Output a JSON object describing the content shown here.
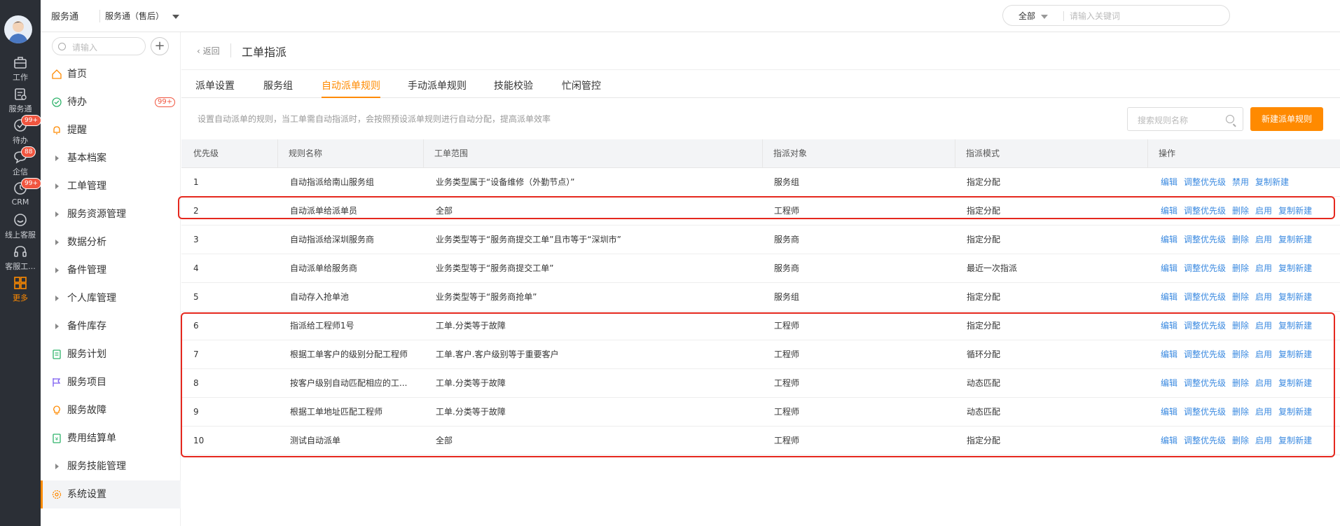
{
  "rail": {
    "items": [
      {
        "label": "工作",
        "icon": "briefcase-icon"
      },
      {
        "label": "服务通",
        "icon": "service-clipboard-icon"
      },
      {
        "label": "待办",
        "icon": "check-circle-icon",
        "badge": "99+"
      },
      {
        "label": "企信",
        "icon": "chat-bubble-icon",
        "badge": "88"
      },
      {
        "label": "CRM",
        "icon": "clock-icon",
        "badge": "99+"
      },
      {
        "label": "线上客服",
        "icon": "smile-icon"
      },
      {
        "label": "客服工...",
        "icon": "headset-icon"
      },
      {
        "label": "更多",
        "icon": "grid-icon"
      }
    ]
  },
  "topbar": {
    "brand": "服务通",
    "app": "服务通（售后）",
    "search_scope": "全部",
    "search_placeholder": "请输入关键词"
  },
  "sidebar": {
    "search_placeholder": "请输入",
    "items": [
      {
        "label": "首页"
      },
      {
        "label": "待办",
        "badge": "99+"
      },
      {
        "label": "提醒"
      },
      {
        "label": "基本档案"
      },
      {
        "label": "工单管理"
      },
      {
        "label": "服务资源管理"
      },
      {
        "label": "数据分析"
      },
      {
        "label": "备件管理"
      },
      {
        "label": "个人库管理"
      },
      {
        "label": "备件库存"
      },
      {
        "label": "服务计划"
      },
      {
        "label": "服务项目"
      },
      {
        "label": "服务故障"
      },
      {
        "label": "费用结算单"
      },
      {
        "label": "服务技能管理"
      },
      {
        "label": "系统设置"
      }
    ]
  },
  "main": {
    "back": "返回",
    "title": "工单指派",
    "tabs": [
      "派单设置",
      "服务组",
      "自动派单规则",
      "手动派单规则",
      "技能校验",
      "忙闲管控"
    ],
    "active_tab": "自动派单规则",
    "hint": "设置自动派单的规则，当工单需自动指派时，会按照预设派单规则进行自动分配，提高派单效率",
    "rule_search_placeholder": "搜索规则名称",
    "new_button": "新建派单规则"
  },
  "table": {
    "headers": [
      "优先级",
      "规则名称",
      "工单范围",
      "指派对象",
      "指派模式",
      "操作"
    ],
    "rows": [
      {
        "priority": "1",
        "name": "自动指派给南山服务组",
        "scope": "业务类型属于“设备维修（外勤节点）”",
        "target": "服务组",
        "mode": "指定分配",
        "ops": [
          "编辑",
          "调整优先级",
          "禁用",
          "复制新建"
        ]
      },
      {
        "priority": "2",
        "name": "自动派单给派单员",
        "scope": "全部",
        "target": "工程师",
        "mode": "指定分配",
        "ops": [
          "编辑",
          "调整优先级",
          "删除",
          "启用",
          "复制新建"
        ]
      },
      {
        "priority": "3",
        "name": "自动指派给深圳服务商",
        "scope": "业务类型等于“服务商提交工单”且市等于“深圳市”",
        "target": "服务商",
        "mode": "指定分配",
        "ops": [
          "编辑",
          "调整优先级",
          "删除",
          "启用",
          "复制新建"
        ]
      },
      {
        "priority": "4",
        "name": "自动派单给服务商",
        "scope": "业务类型等于“服务商提交工单”",
        "target": "服务商",
        "mode": "最近一次指派",
        "ops": [
          "编辑",
          "调整优先级",
          "删除",
          "启用",
          "复制新建"
        ]
      },
      {
        "priority": "5",
        "name": "自动存入抢单池",
        "scope": "业务类型等于“服务商抢单”",
        "target": "服务组",
        "mode": "指定分配",
        "ops": [
          "编辑",
          "调整优先级",
          "删除",
          "启用",
          "复制新建"
        ]
      },
      {
        "priority": "6",
        "name": "指派给工程师1号",
        "scope": "工单.分类等于故障",
        "target": "工程师",
        "mode": "指定分配",
        "ops": [
          "编辑",
          "调整优先级",
          "删除",
          "启用",
          "复制新建"
        ]
      },
      {
        "priority": "7",
        "name": "根据工单客户的级别分配工程师",
        "scope": "工单.客户.客户级别等于重要客户",
        "target": "工程师",
        "mode": "循环分配",
        "ops": [
          "编辑",
          "调整优先级",
          "删除",
          "启用",
          "复制新建"
        ]
      },
      {
        "priority": "8",
        "name": "按客户级别自动匹配相应的工...",
        "scope": "工单.分类等于故障",
        "target": "工程师",
        "mode": "动态匹配",
        "ops": [
          "编辑",
          "调整优先级",
          "删除",
          "启用",
          "复制新建"
        ]
      },
      {
        "priority": "9",
        "name": "根据工单地址匹配工程师",
        "scope": "工单.分类等于故障",
        "target": "工程师",
        "mode": "动态匹配",
        "ops": [
          "编辑",
          "调整优先级",
          "删除",
          "启用",
          "复制新建"
        ]
      },
      {
        "priority": "10",
        "name": "测试自动派单",
        "scope": "全部",
        "target": "工程师",
        "mode": "指定分配",
        "ops": [
          "编辑",
          "调整优先级",
          "删除",
          "启用",
          "复制新建"
        ]
      }
    ]
  },
  "colors": {
    "accent": "#ff8a00",
    "link": "#3b8ae0",
    "highlight": "#e5281e",
    "rail": "#2b2f36"
  }
}
